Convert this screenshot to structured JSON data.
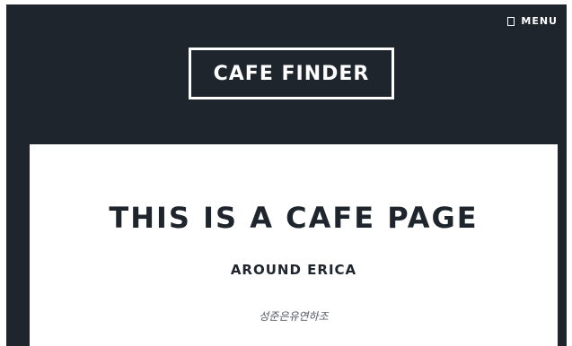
{
  "nav": {
    "menu_label": "MENU",
    "menu_icon": "menu-icon"
  },
  "brand": {
    "title": "CAFE FINDER"
  },
  "main": {
    "title": "THIS IS A CAFE PAGE",
    "subtitle": "AROUND ERICA",
    "byline": "성준은유연하조"
  },
  "colors": {
    "background": "#1f252d",
    "card": "#ffffff",
    "text_light": "#ffffff",
    "text_dark": "#1f252d"
  }
}
